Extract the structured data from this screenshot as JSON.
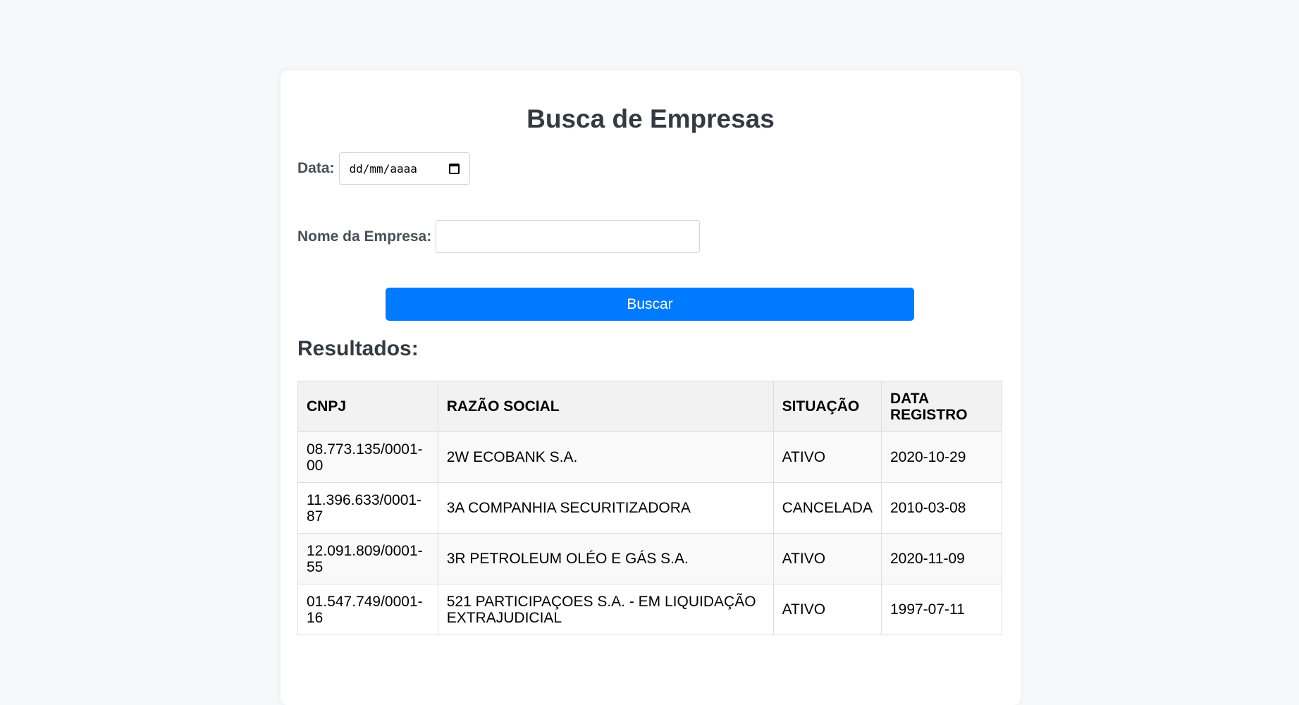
{
  "page": {
    "title": "Busca de Empresas"
  },
  "form": {
    "date_label": "Data:",
    "date_placeholder": "dd/mm/aaaa",
    "name_label": "Nome da Empresa:",
    "name_value": "",
    "submit_label": "Buscar"
  },
  "results": {
    "heading": "Resultados:",
    "columns": [
      "CNPJ",
      "RAZÃO SOCIAL",
      "SITUAÇÃO",
      "DATA REGISTRO"
    ],
    "rows": [
      [
        "08.773.135/0001-00",
        "2W ECOBANK S.A.",
        "ATIVO",
        "2020-10-29"
      ],
      [
        "11.396.633/0001-87",
        "3A COMPANHIA SECURITIZADORA",
        "CANCELADA",
        "2010-03-08"
      ],
      [
        "12.091.809/0001-55",
        "3R PETROLEUM OLÉO E GÁS S.A.",
        "ATIVO",
        "2020-11-09"
      ],
      [
        "01.547.749/0001-16",
        "521 PARTICIPAÇOES S.A. - EM LIQUIDAÇÃO EXTRAJUDICIAL",
        "ATIVO",
        "1997-07-11"
      ]
    ]
  },
  "colors": {
    "primary_button": "#007bff",
    "page_background": "#f7f8fa",
    "heading_text": "#343a40"
  },
  "icons": {
    "date_picker": "calendar-icon"
  }
}
